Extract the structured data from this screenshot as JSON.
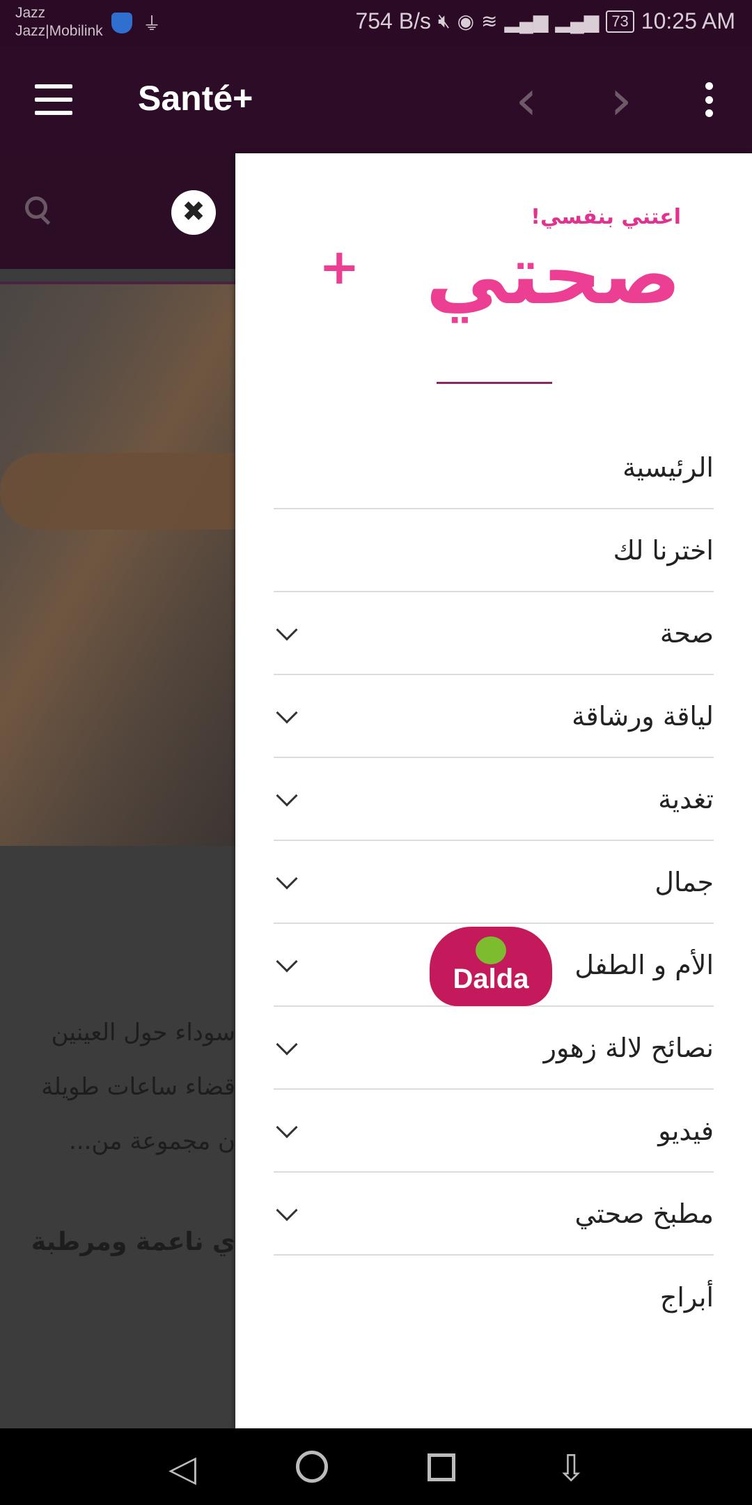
{
  "status_bar": {
    "carrier_line1": "Jazz",
    "carrier_line2": "Jazz|Mobilink",
    "speed": "754 B/s",
    "battery": "73",
    "time": "10:25 AM"
  },
  "app_bar": {
    "title": "Santé+"
  },
  "background": {
    "line1": "سوداء حول العينين",
    "line2": "قضاء ساعات طويلة",
    "line3": "ن مجموعة من...",
    "bold_line": "ي ناعمة ومرطبة"
  },
  "drawer": {
    "logo_tagline": "اعتني بنفسي!",
    "logo_text": "صحتي",
    "menu": [
      {
        "label": "الرئيسية",
        "expandable": false
      },
      {
        "label": "اخترنا لك",
        "expandable": false
      },
      {
        "label": "صحة",
        "expandable": true
      },
      {
        "label": "لياقة ورشاقة",
        "expandable": true
      },
      {
        "label": "تغدية",
        "expandable": true
      },
      {
        "label": "جمال",
        "expandable": true
      },
      {
        "label": "الأم و الطفل",
        "expandable": true
      },
      {
        "label": "نصائح لالة زهور",
        "expandable": true
      },
      {
        "label": "فيديو",
        "expandable": true
      },
      {
        "label": "مطبخ صحتي",
        "expandable": true
      },
      {
        "label": "أبراج",
        "expandable": false
      }
    ],
    "sponsor": "Dalda"
  },
  "colors": {
    "app_bar": "#2c0c27",
    "brand_pink": "#ec3f93",
    "drawer_bg": "#ffffff"
  }
}
